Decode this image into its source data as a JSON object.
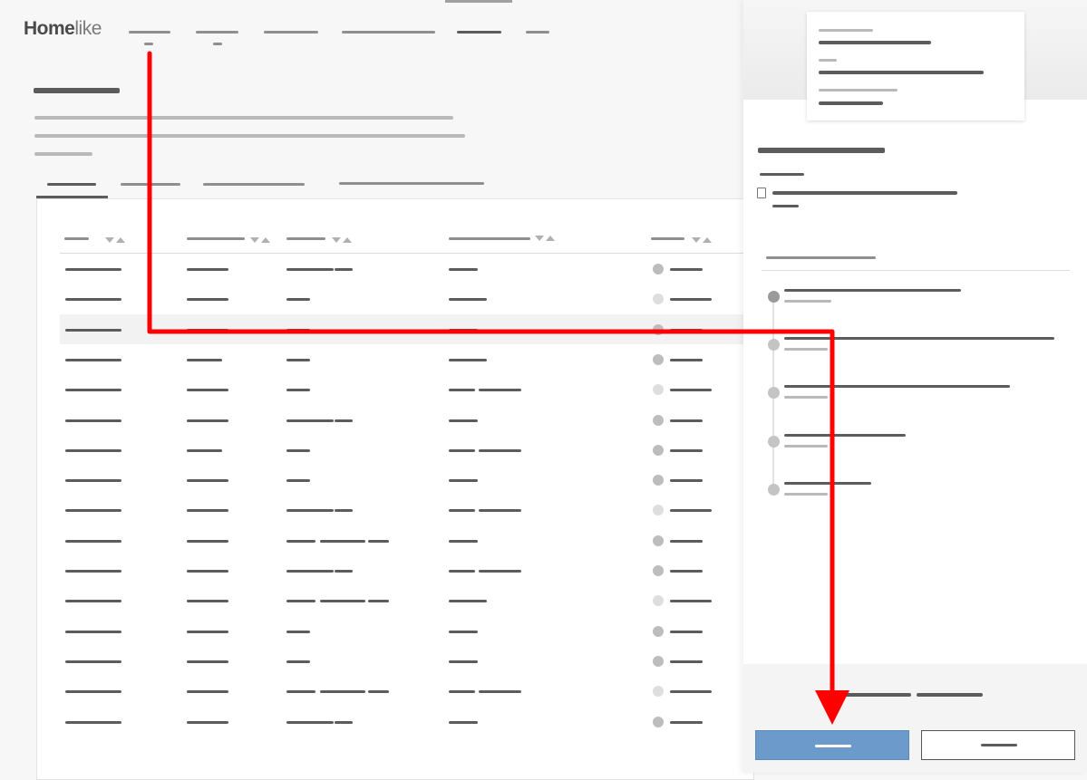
{
  "app": {
    "logo_primary": "Home",
    "logo_secondary": "like"
  },
  "colors": {
    "primary_button": "#6b9acb",
    "annotation_arrow": "#ff0000",
    "text_placeholder": "#5c5c5c"
  },
  "icons": [
    "document-icon",
    "sort-arrows-icon",
    "status-dot-icon"
  ]
}
